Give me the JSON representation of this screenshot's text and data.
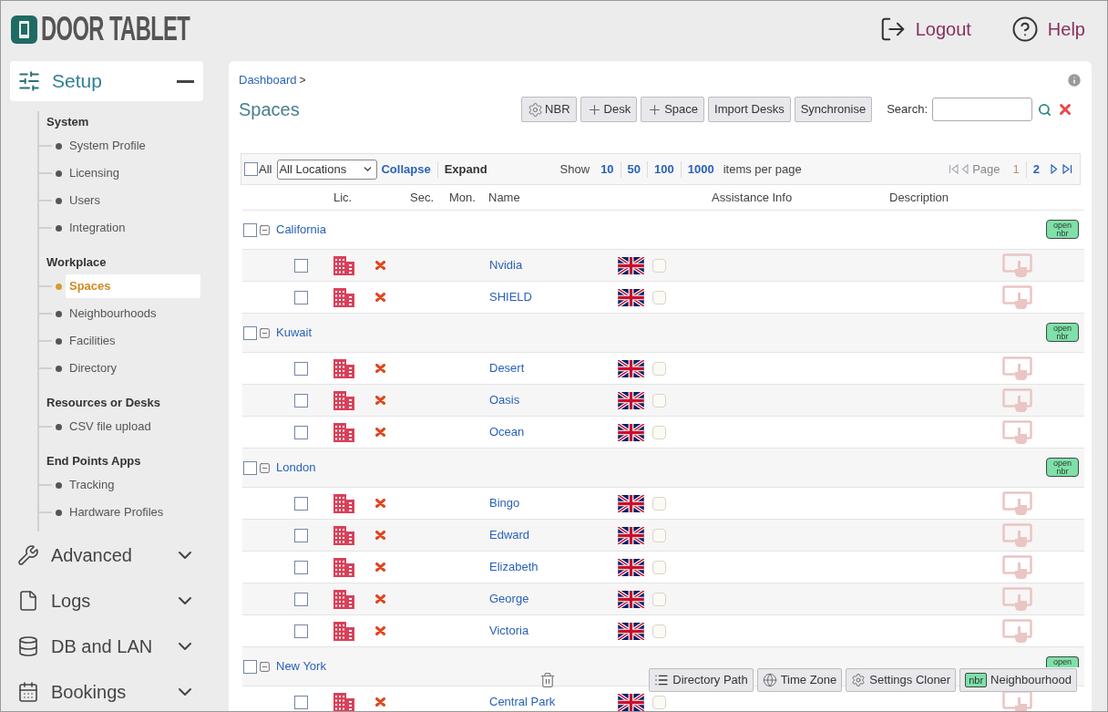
{
  "header": {
    "logo": "DOOR TABLET",
    "links": [
      {
        "kind": "logout",
        "label": "Logout"
      },
      {
        "kind": "help",
        "label": "Help"
      }
    ]
  },
  "sidebar": {
    "section": {
      "label": "Setup",
      "expanded": true,
      "groups": [
        {
          "title": "System",
          "items": [
            {
              "label": "System Profile",
              "selected": false
            },
            {
              "label": "Licensing",
              "selected": false
            },
            {
              "label": "Users",
              "selected": false
            },
            {
              "label": "Integration",
              "selected": false
            }
          ]
        },
        {
          "title": "Workplace",
          "items": [
            {
              "label": "Spaces",
              "selected": true
            },
            {
              "label": "Neighbourhoods",
              "selected": false
            },
            {
              "label": "Facilities",
              "selected": false
            },
            {
              "label": "Directory",
              "selected": false
            }
          ]
        },
        {
          "title": "Resources or Desks",
          "items": [
            {
              "label": "CSV file upload",
              "selected": false
            }
          ]
        },
        {
          "title": "End Points Apps",
          "items": [
            {
              "label": "Tracking",
              "selected": false
            },
            {
              "label": "Hardware Profiles",
              "selected": false
            }
          ]
        }
      ]
    },
    "menus": [
      {
        "kind": "wrench",
        "label": "Advanced",
        "expanded": false
      },
      {
        "kind": "file",
        "label": "Logs",
        "expanded": false
      },
      {
        "kind": "database",
        "label": "DB and LAN",
        "expanded": false
      },
      {
        "kind": "calendar",
        "label": "Bookings",
        "expanded": false
      }
    ]
  },
  "breadcrumb": {
    "link": "Dashboard",
    "separator": ">"
  },
  "title": "Spaces",
  "toolbar": [
    {
      "kind": "gear",
      "label": "NBR"
    },
    {
      "kind": "plus",
      "label": "Desk"
    },
    {
      "kind": "plus",
      "label": "Space"
    },
    {
      "kind": "plain",
      "label": "Import Desks"
    },
    {
      "kind": "plain",
      "label": "Synchronise"
    }
  ],
  "search": {
    "label": "Search:"
  },
  "list_bar": {
    "all": {
      "label": "All",
      "checked": false
    },
    "location": "All Locations",
    "collapse": "Collapse",
    "expand": "Expand",
    "show": "Show",
    "page_sizes": [
      "10",
      "50",
      "100",
      "1000"
    ],
    "per_page": "items per page",
    "page_label": "Page",
    "pages": [
      {
        "label": "1",
        "selected": true
      },
      {
        "label": "2",
        "selected": false
      }
    ]
  },
  "columns": [
    {
      "label": "Lic."
    },
    {
      "label": "Sec."
    },
    {
      "label": "Mon."
    },
    {
      "label": "Name"
    },
    {
      "label": "Assistance Info"
    },
    {
      "label": "Description"
    }
  ],
  "groups": [
    {
      "name": "California",
      "checked": false,
      "expanded": true,
      "badge": [
        "open",
        "nbr"
      ],
      "spaces": [
        {
          "name": "Nvidia",
          "checked": false,
          "monitored": false
        },
        {
          "name": "SHIELD",
          "checked": false,
          "monitored": false
        }
      ]
    },
    {
      "name": "Kuwait",
      "checked": false,
      "expanded": true,
      "badge": [
        "open",
        "nbr"
      ],
      "spaces": [
        {
          "name": "Desert",
          "checked": false,
          "monitored": false
        },
        {
          "name": "Oasis",
          "checked": false,
          "monitored": false
        },
        {
          "name": "Ocean",
          "checked": false,
          "monitored": false
        }
      ]
    },
    {
      "name": "London",
      "checked": false,
      "expanded": true,
      "badge": [
        "open",
        "nbr"
      ],
      "spaces": [
        {
          "name": "Bingo",
          "checked": false,
          "monitored": false
        },
        {
          "name": "Edward",
          "checked": false,
          "monitored": false
        },
        {
          "name": "Elizabeth",
          "checked": false,
          "monitored": false
        },
        {
          "name": "George",
          "checked": false,
          "monitored": false
        },
        {
          "name": "Victoria",
          "checked": false,
          "monitored": false
        }
      ]
    },
    {
      "name": "New York",
      "checked": false,
      "expanded": true,
      "badge": [
        "open"
      ],
      "spaces": [
        {
          "name": "Central Park",
          "checked": false,
          "monitored": false
        }
      ]
    }
  ],
  "bottom_toolbar": [
    {
      "kind": "list",
      "label": "Directory Path"
    },
    {
      "kind": "globe",
      "label": "Time Zone"
    },
    {
      "kind": "gear",
      "label": "Settings Cloner"
    },
    {
      "kind": "nbr",
      "tag": "nbr",
      "label": "Neighbourhood"
    }
  ]
}
